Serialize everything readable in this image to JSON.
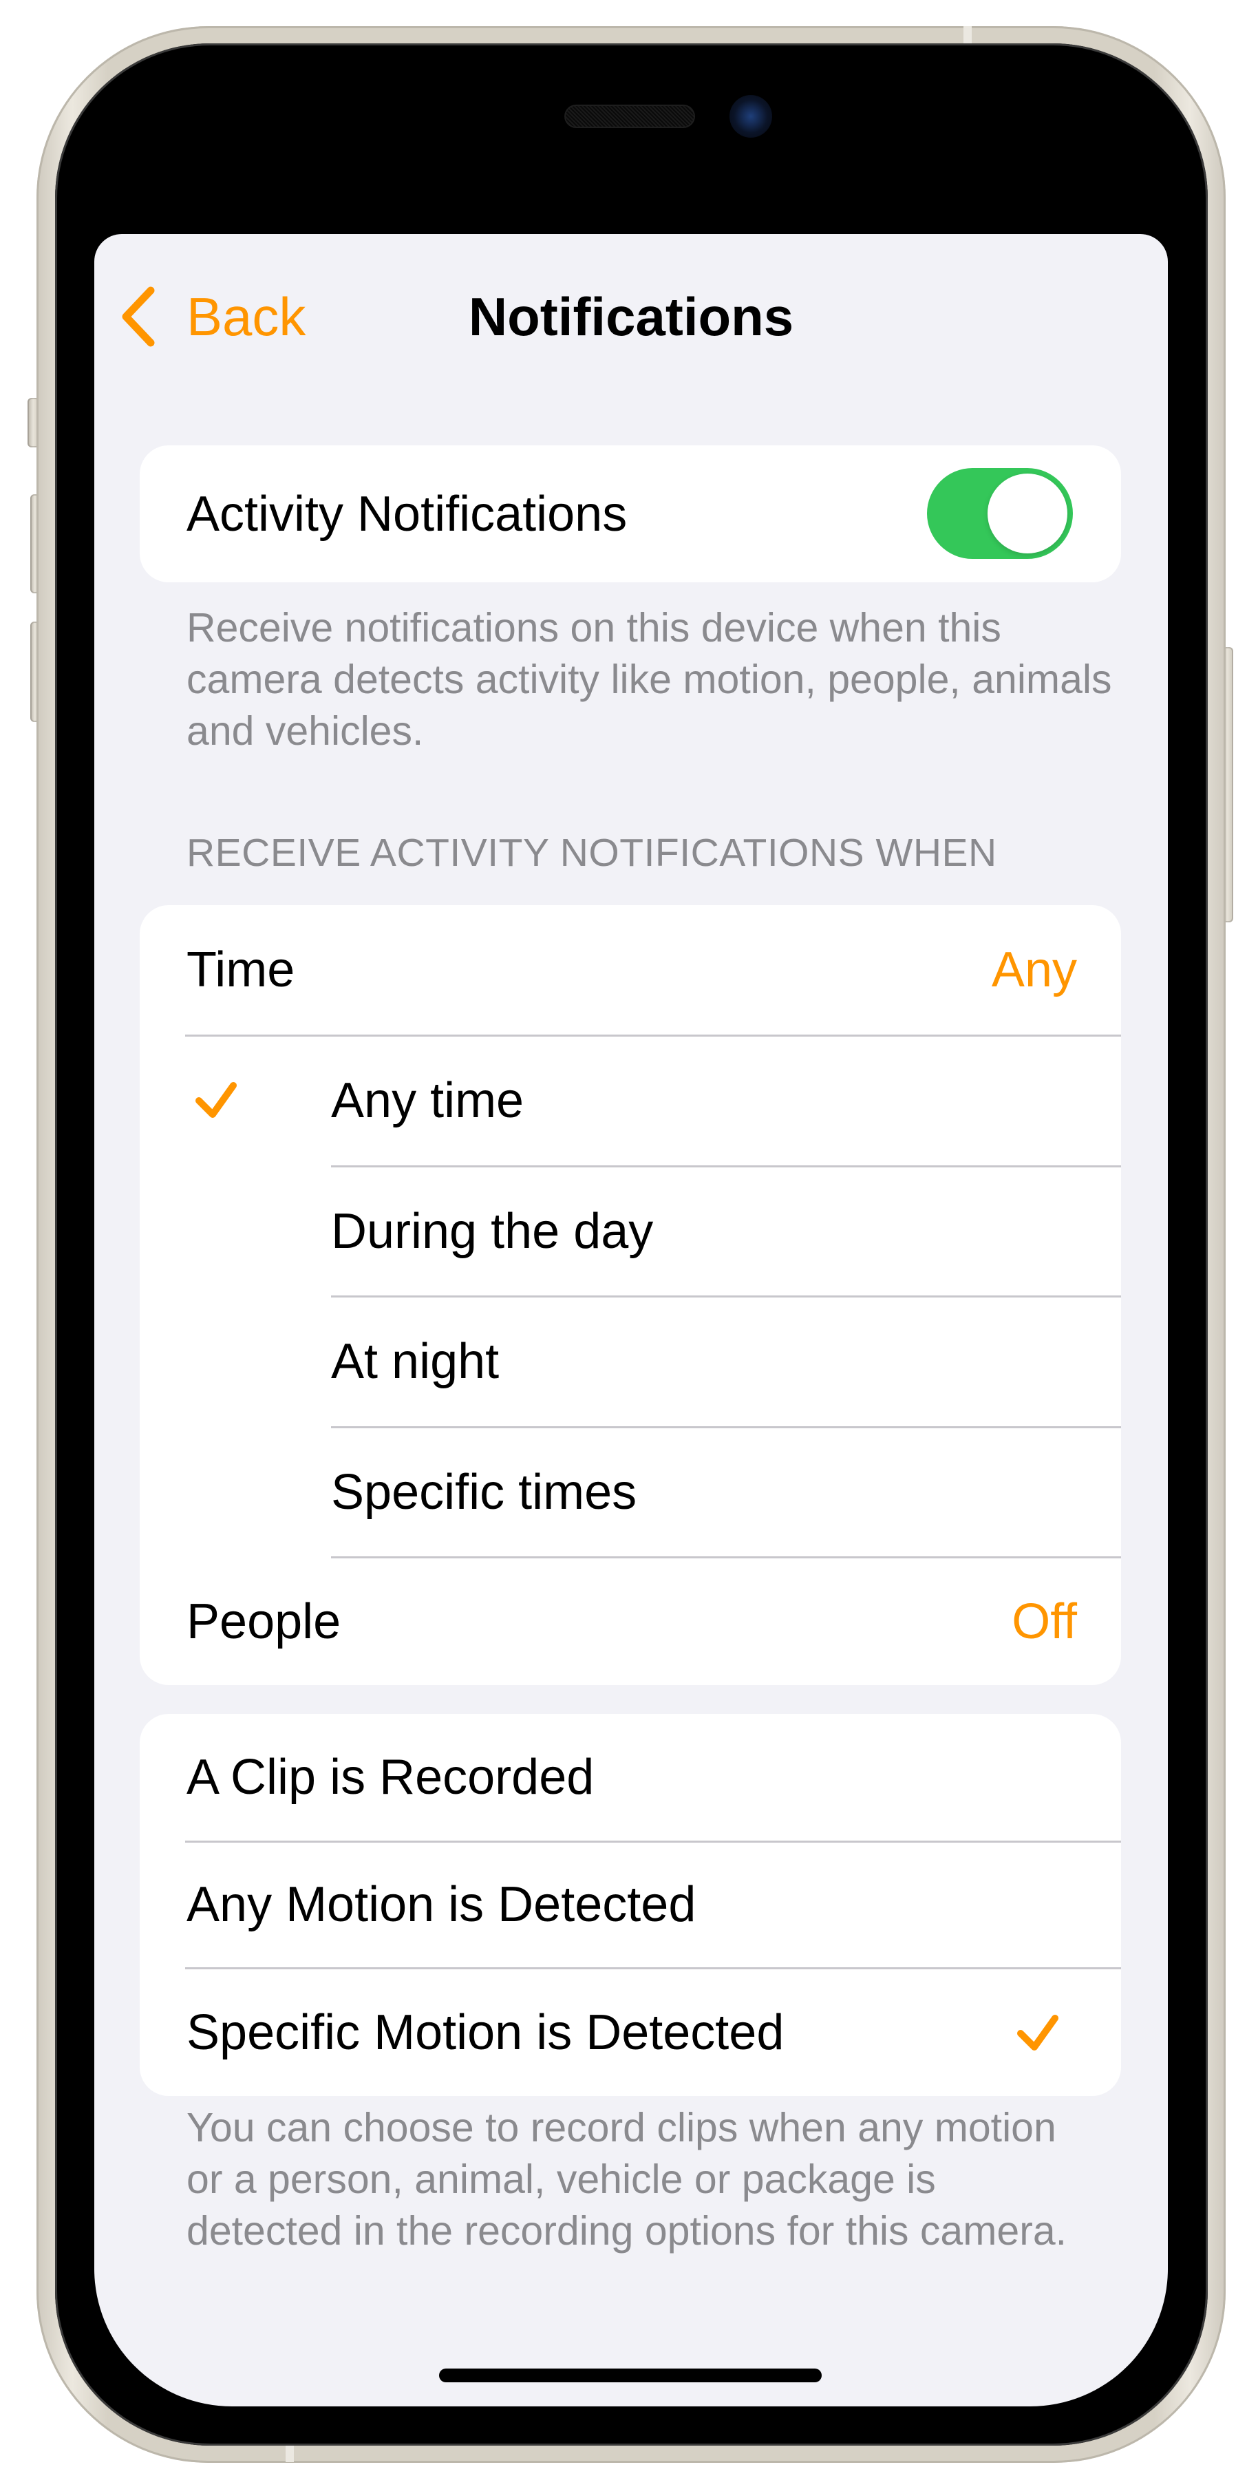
{
  "nav": {
    "back_label": "Back",
    "title": "Notifications"
  },
  "activity": {
    "label": "Activity Notifications",
    "toggle_on": true,
    "footer": "Receive notifications on this device when this camera detects activity like motion, people, animals and vehicles."
  },
  "receive_section": {
    "header": "RECEIVE ACTIVITY NOTIFICATIONS WHEN",
    "time": {
      "label": "Time",
      "value": "Any"
    },
    "time_options": [
      {
        "label": "Any time",
        "selected": true
      },
      {
        "label": "During the day",
        "selected": false
      },
      {
        "label": "At night",
        "selected": false
      },
      {
        "label": "Specific times",
        "selected": false
      }
    ],
    "people": {
      "label": "People",
      "value": "Off"
    }
  },
  "recording_section": {
    "options": [
      {
        "label": "A Clip is Recorded",
        "selected": false
      },
      {
        "label": "Any Motion is Detected",
        "selected": false
      },
      {
        "label": "Specific Motion is Detected",
        "selected": true
      }
    ],
    "footer": "You can choose to record clips when any motion or a person, animal, vehicle or package is detected in the recording options for this camera."
  },
  "colors": {
    "accent": "#ff9500",
    "toggle_on": "#34c759",
    "background": "#f2f2f7",
    "secondary_text": "#8a8a8e"
  },
  "icons": {
    "back": "chevron-left-icon",
    "selected": "checkmark-icon"
  }
}
